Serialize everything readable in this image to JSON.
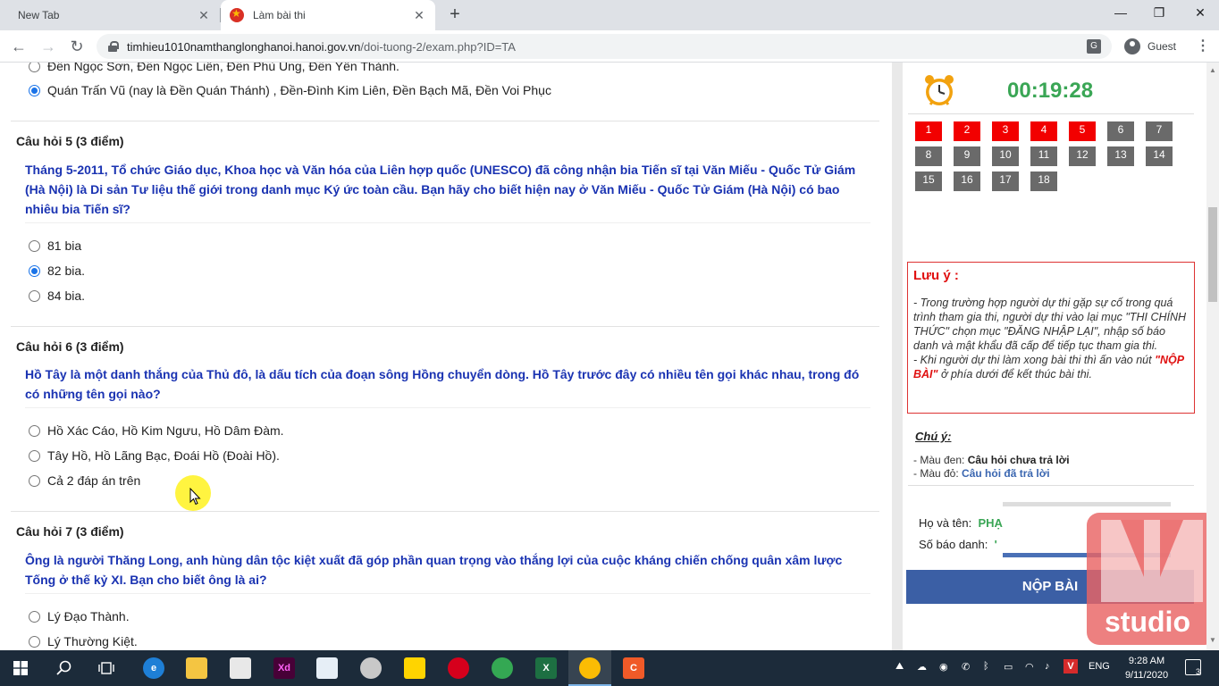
{
  "browser": {
    "tabs": [
      {
        "label": "New Tab"
      },
      {
        "label": "Làm bài thi"
      }
    ],
    "url_host": "timhieu1010namthanglonghanoi.hanoi.gov.vn",
    "url_path": "/doi-tuong-2/exam.php?ID=TA",
    "profile_label": "Guest",
    "icons": {
      "close": "✕",
      "new_tab": "+",
      "back": "←",
      "forward": "→",
      "reload": "↻",
      "menu": "⋮",
      "minimize": "—",
      "restore": "❐",
      "window_close": "✕"
    }
  },
  "questions": {
    "q4": {
      "options": [
        {
          "label": "Đền Ngọc Sơn, Đền Ngọc Liên, Đền Phù Ủng, Đền Yên Thành.",
          "checked": false
        },
        {
          "label": "Quán Trấn Vũ (nay là Đền Quán Thánh) , Đền-Đình Kim Liên, Đền Bạch Mã, Đền Voi Phục",
          "checked": true
        }
      ]
    },
    "q5": {
      "title": "Câu hỏi 5 (3 điểm)",
      "text": "Tháng 5-2011, Tổ chức Giáo dục, Khoa học và Văn hóa của Liên hợp quốc (UNESCO) đã công nhận bia Tiến sĩ tại Văn Miếu - Quốc Tử Giám (Hà Nội) là Di sản Tư liệu thế giới trong danh mục Ký ức toàn cầu. Bạn hãy cho biết hiện nay ở Văn Miếu - Quốc Tử Giám (Hà Nội) có bao nhiêu bia Tiến sĩ?",
      "options": [
        {
          "label": "81 bia",
          "checked": false
        },
        {
          "label": "82 bia.",
          "checked": true
        },
        {
          "label": "84 bia.",
          "checked": false
        }
      ]
    },
    "q6": {
      "title": "Câu hỏi 6 (3 điểm)",
      "text": "Hồ Tây là một danh thắng của Thủ đô, là dấu tích của đoạn sông Hồng chuyển dòng. Hồ Tây trước đây có nhiều tên gọi khác nhau, trong đó có những tên gọi nào?",
      "options": [
        {
          "label": "Hồ Xác Cáo, Hồ Kim Ngưu, Hồ Dâm Đàm.",
          "checked": false
        },
        {
          "label": "Tây Hồ, Hồ Lãng Bạc, Đoái Hồ (Đoài Hồ).",
          "checked": false
        },
        {
          "label": "Cả 2 đáp án trên",
          "checked": false
        }
      ]
    },
    "q7": {
      "title": "Câu hỏi 7 (3 điểm)",
      "text": "Ông là người Thăng Long, anh hùng dân tộc kiệt xuất đã góp phần quan trọng vào thắng lợi của cuộc kháng chiến chống quân xâm lược Tống ở thế kỷ XI. Bạn cho biết ông là ai?",
      "options": [
        {
          "label": "Lý Đạo Thành.",
          "checked": false
        },
        {
          "label": "Lý Thường Kiệt.",
          "checked": false
        }
      ]
    }
  },
  "sidebar": {
    "timer": "00:19:28",
    "question_numbers": [
      {
        "n": "1",
        "answered": true
      },
      {
        "n": "2",
        "answered": true
      },
      {
        "n": "3",
        "answered": true
      },
      {
        "n": "4",
        "answered": true
      },
      {
        "n": "5",
        "answered": true
      },
      {
        "n": "6",
        "answered": false
      },
      {
        "n": "7",
        "answered": false
      },
      {
        "n": "8",
        "answered": false
      },
      {
        "n": "9",
        "answered": false
      },
      {
        "n": "10",
        "answered": false
      },
      {
        "n": "11",
        "answered": false
      },
      {
        "n": "12",
        "answered": false
      },
      {
        "n": "13",
        "answered": false
      },
      {
        "n": "14",
        "answered": false
      },
      {
        "n": "15",
        "answered": false
      },
      {
        "n": "16",
        "answered": false
      },
      {
        "n": "17",
        "answered": false
      },
      {
        "n": "18",
        "answered": false
      }
    ],
    "note": {
      "title": "Lưu ý :",
      "line1": "- Trong trường hợp người dự thi gặp sự cố trong quá trình tham gia thi, người dự thi vào lại mục \"THI CHÍNH THỨC\" chọn mục \"ĐĂNG NHẬP LẠI\", nhập số báo danh và mật khẩu đã cấp để tiếp tục tham gia thi.",
      "line2_a": "- Khi người dự thi làm xong bài thi thì ấn vào nút",
      "line2_hl": "\"NỘP BÀI\"",
      "line2_b": "ở phía dưới để kết thúc bài thi."
    },
    "legend": {
      "title": "Chú ý:",
      "black_prefix": "- Màu đen:",
      "black_text": "Câu hỏi chưa trả lời",
      "red_prefix": "- Màu đỏ:",
      "red_text": "Câu hỏi đã trả lời"
    },
    "info": {
      "name_label": "Họ và tên:",
      "name_value": "PHẠ",
      "id_label": "Số báo danh:",
      "id_value": "'"
    },
    "submit_label": "NỘP BÀI",
    "watermark_text": "studio"
  },
  "taskbar": {
    "time": "9:28 AM",
    "date": "9/11/2020",
    "language": "ENG",
    "notifications": "3"
  },
  "colors": {
    "answered": "#f20000",
    "unanswered": "#6a6a6a",
    "question_text": "#1a33b2",
    "timer": "#3aa655",
    "submit": "#3b5fa5"
  }
}
